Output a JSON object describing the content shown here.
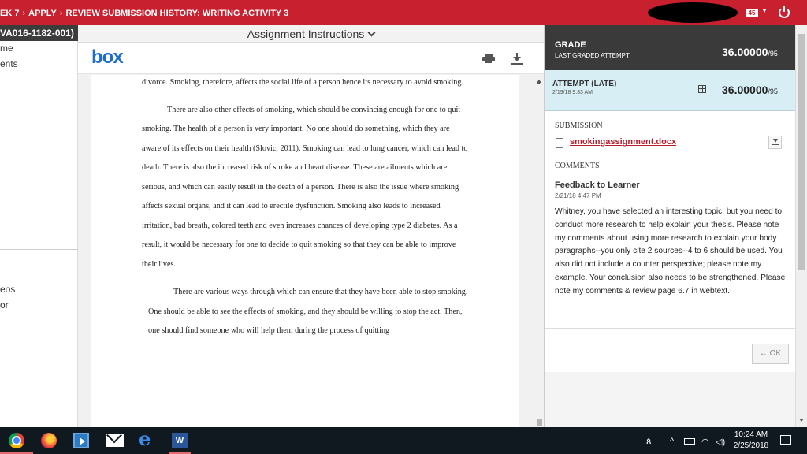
{
  "topbar": {
    "crumb1": "EK 7",
    "crumb2": "APPLY",
    "crumb3": "REVIEW SUBMISSION HISTORY: WRITING ACTIVITY 3",
    "sep": "›",
    "notif_count": "45",
    "caret": "▼",
    "accent": "#c8202f"
  },
  "sidebar": {
    "course_code": "VA016-1182-001)",
    "items": [
      "me",
      "ents",
      "eos",
      "or"
    ]
  },
  "instructions": {
    "header": "Assignment Instructions"
  },
  "viewer": {
    "logo": "box",
    "paragraphs": [
      "divorce. Smoking, therefore, affects the social life of a person hence its necessary to avoid smoking.",
      "There are also other effects of smoking, which should be convincing enough for one to quit smoking. The health of a person is very important. No one should do something, which they are aware of its effects on their health (Slovic, 2011). Smoking can lead to lung cancer, which can lead to death. There is also the increased risk of stroke and heart disease. These are ailments which are serious, and which can easily result in the death of a person. There is also the issue where smoking affects sexual organs, and it can lead to erectile dysfunction. Smoking also leads to increased irritation, bad breath, colored teeth and even increases chances of developing type 2 diabetes. As a result, it would be necessary for one to decide to quit smoking so that they can be able to improve their lives.",
      "There are various ways through which can ensure that they have been able to stop smoking. One should be able to see the effects of smoking, and they should be willing to stop the act. Then, one should find someone who will help them during the process of quitting"
    ]
  },
  "panel": {
    "grade_label": "GRADE",
    "grade_sub": "LAST GRADED ATTEMPT",
    "grade_value": "36.00000",
    "grade_max": "/95",
    "attempt_label": "ATTEMPT (LATE)",
    "attempt_date": "2/19/18 9:33 AM",
    "attempt_value": "36.00000",
    "attempt_max": "/95",
    "submission_label": "SUBMISSION",
    "file_name": "smokingassignment.docx",
    "comments_label": "COMMENTS",
    "feedback_title": "Feedback to Learner",
    "feedback_date": "2/21/18 4:47 PM",
    "feedback_body": "Whitney, you have selected an interesting topic, but you need to conduct more research to help explain your thesis. Please note my comments about using more research to explain your body paragraphs--you only cite 2 sources--4 to 6 should be used.  You also did not include a counter perspective; please note my example.  Your conclusion also needs to be strengthened.  Please note my comments & review page 6.7 in webtext.",
    "ok_label": "← OK"
  },
  "taskbar": {
    "word_label": "W",
    "edge_label": "e",
    "time": "10:24 AM",
    "date": "2/25/2018",
    "tray_person": "ጰ",
    "tray_up": "^"
  }
}
